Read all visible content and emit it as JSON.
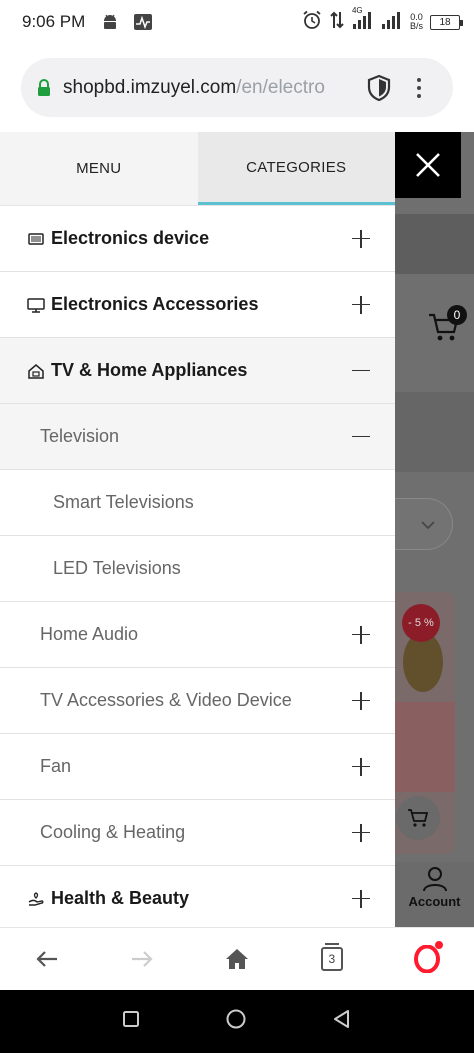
{
  "status_bar": {
    "time": "9:06 PM",
    "net_speed_value": "0.0",
    "net_speed_unit": "B/s",
    "network_type": "4G",
    "battery": "18",
    "icons": [
      "android-icon",
      "activity-icon",
      "alarm-icon",
      "data-transfer-icon",
      "signal-icon",
      "signal-icon",
      "battery-icon"
    ]
  },
  "browser": {
    "url_domain": "shopbd.imzuyel.com",
    "url_path": "/en/electro",
    "tab_count": "3"
  },
  "drawer": {
    "tabs": [
      {
        "label": "MENU"
      },
      {
        "label": "CATEGORIES"
      }
    ],
    "active_tab": "CATEGORIES",
    "accent_color": "#5bc0d0",
    "categories": [
      {
        "label": "Electronics device",
        "level": 0,
        "icon": "circuit-board-icon",
        "state": "collapsed"
      },
      {
        "label": "Electronics Accessories",
        "level": 0,
        "icon": "monitor-icon",
        "state": "collapsed"
      },
      {
        "label": "TV & Home Appliances",
        "level": 0,
        "icon": "home-icon",
        "state": "expanded"
      },
      {
        "label": "Television",
        "level": 1,
        "state": "expanded"
      },
      {
        "label": "Smart Televisions",
        "level": 2
      },
      {
        "label": "LED Televisions",
        "level": 2
      },
      {
        "label": "Home Audio",
        "level": 1,
        "state": "collapsed"
      },
      {
        "label": "TV Accessories & Video Device",
        "level": 1,
        "state": "collapsed"
      },
      {
        "label": "Fan",
        "level": 1,
        "state": "collapsed"
      },
      {
        "label": "Cooling & Heating",
        "level": 1,
        "state": "collapsed"
      },
      {
        "label": "Health & Beauty",
        "level": 0,
        "icon": "hand-care-icon",
        "state": "collapsed"
      }
    ]
  },
  "background_page": {
    "cart_count": "0",
    "discount_badge": "- 5 %",
    "account_label": "Account"
  }
}
